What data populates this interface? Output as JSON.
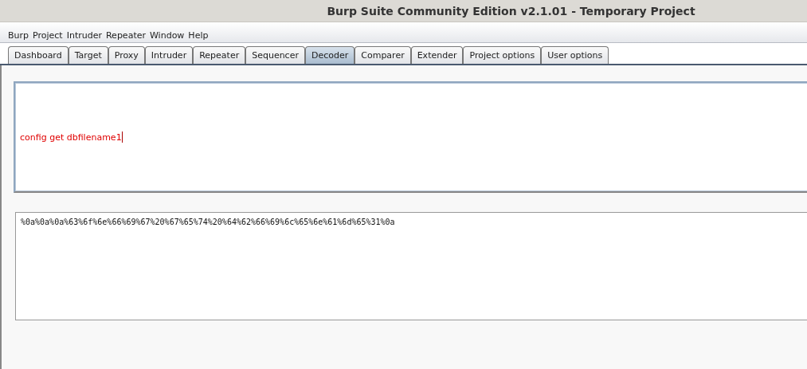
{
  "window": {
    "title": "Burp Suite Community Edition v2.1.01 - Temporary Project"
  },
  "menu": [
    "Burp",
    "Project",
    "Intruder",
    "Repeater",
    "Window",
    "Help"
  ],
  "tabs": [
    {
      "label": "Dashboard",
      "selected": false
    },
    {
      "label": "Target",
      "selected": false
    },
    {
      "label": "Proxy",
      "selected": false
    },
    {
      "label": "Intruder",
      "selected": false
    },
    {
      "label": "Repeater",
      "selected": false
    },
    {
      "label": "Sequencer",
      "selected": false
    },
    {
      "label": "Decoder",
      "selected": true
    },
    {
      "label": "Comparer",
      "selected": false
    },
    {
      "label": "Extender",
      "selected": false
    },
    {
      "label": "Project options",
      "selected": false
    },
    {
      "label": "User options",
      "selected": false
    }
  ],
  "decoder": {
    "input": {
      "value": "config get dbfilename1",
      "focused": true
    },
    "output": {
      "value": "%0a%0a%0a%63%6f%6e%66%69%67%20%67%65%74%20%64%62%66%69%6c%65%6e%61%6d%65%31%0a"
    }
  }
}
